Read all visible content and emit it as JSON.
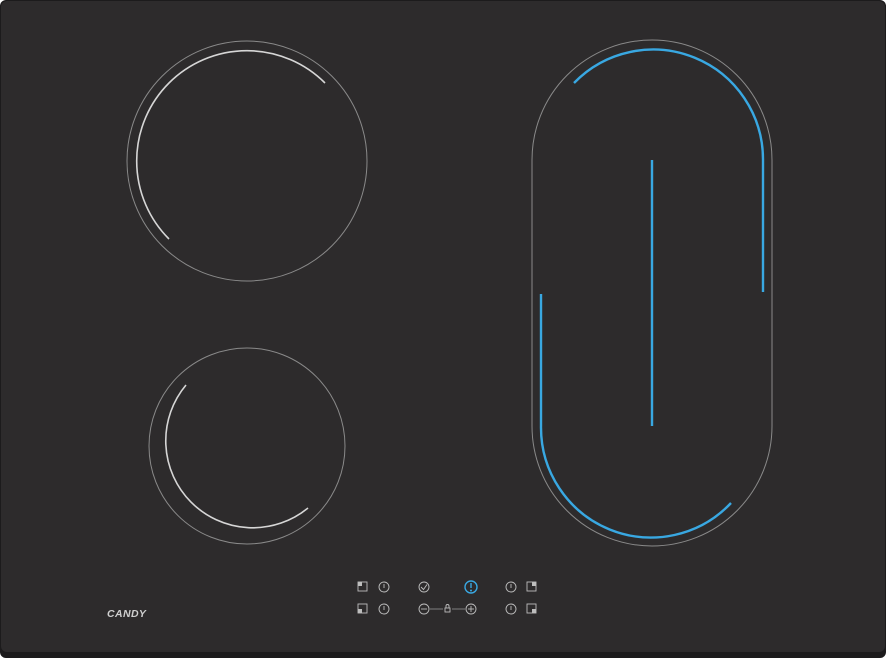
{
  "brand": {
    "logo_text": "CANDY"
  },
  "colors": {
    "glass": "#2d2b2c",
    "edge": "#1c1b1c",
    "zone_outline": "#8a8a8a",
    "idle_arc": "#d6d6d6",
    "active_arc": "#39a8e2"
  },
  "zones": [
    {
      "id": "rear-left",
      "state": "idle"
    },
    {
      "id": "front-left",
      "state": "idle"
    },
    {
      "id": "right-oval-bridge",
      "state": "active"
    }
  ],
  "controls": {
    "top_row": [
      {
        "id": "zone-select-rear-left",
        "icon": "zone-rear-left-icon"
      },
      {
        "id": "timer-rear-left",
        "icon": "timer-icon"
      },
      {
        "id": "check",
        "icon": "check-icon"
      },
      {
        "id": "power",
        "icon": "power-icon",
        "active": true
      },
      {
        "id": "timer-rear-right",
        "icon": "timer-icon"
      },
      {
        "id": "zone-select-rear-right",
        "icon": "zone-rear-right-icon"
      }
    ],
    "bottom_row": [
      {
        "id": "zone-select-front-left",
        "icon": "zone-front-left-icon"
      },
      {
        "id": "timer-front-left",
        "icon": "timer-icon"
      },
      {
        "id": "minus",
        "icon": "minus-icon"
      },
      {
        "id": "lock",
        "icon": "lock-icon"
      },
      {
        "id": "plus",
        "icon": "plus-icon"
      },
      {
        "id": "timer-front-right",
        "icon": "timer-icon"
      },
      {
        "id": "zone-select-front-right",
        "icon": "zone-front-right-icon"
      }
    ]
  }
}
